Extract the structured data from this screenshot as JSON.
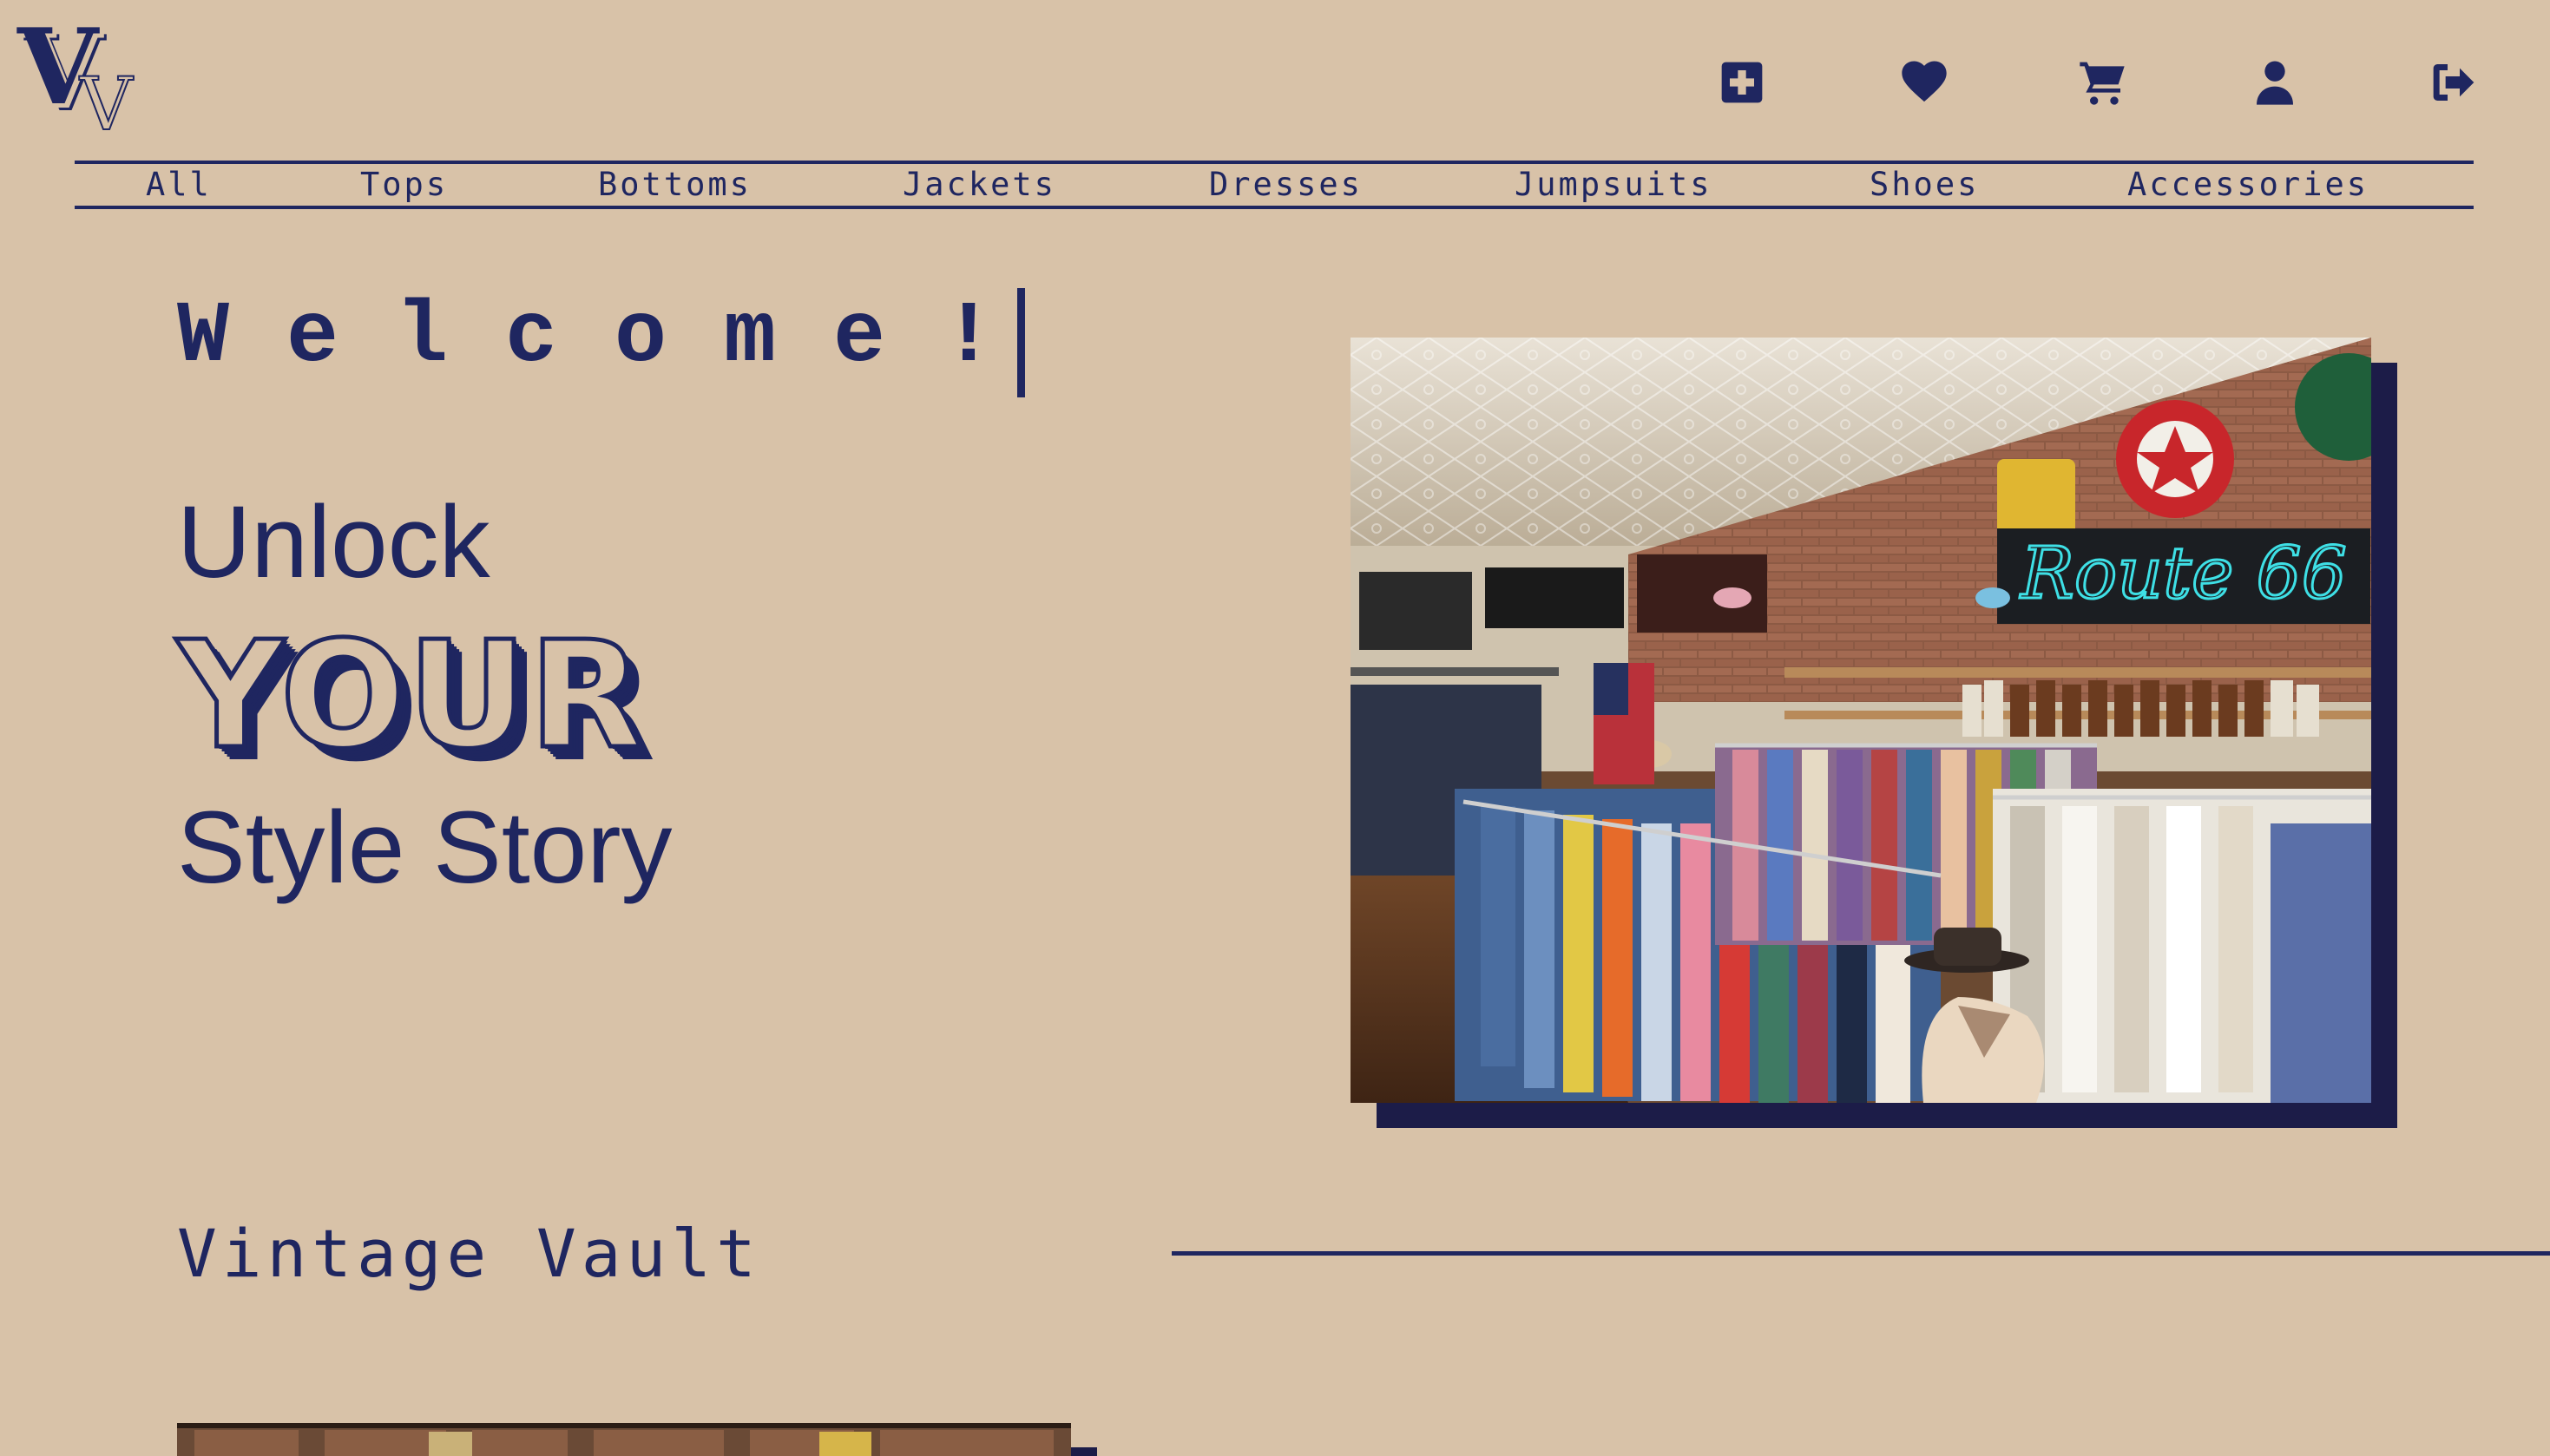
{
  "logo": {
    "big_letter": "V",
    "small_letter": "V"
  },
  "header_icons": [
    {
      "name": "add-icon",
      "label": "Add"
    },
    {
      "name": "heart-icon",
      "label": "Favorites"
    },
    {
      "name": "cart-icon",
      "label": "Cart"
    },
    {
      "name": "user-icon",
      "label": "Account"
    },
    {
      "name": "logout-icon",
      "label": "Log out"
    }
  ],
  "nav": {
    "items": [
      "All",
      "Tops",
      "Bottoms",
      "Jackets",
      "Dresses",
      "Jumpsuits",
      "Shoes",
      "Accessories"
    ]
  },
  "hero": {
    "welcome": "Welcome!",
    "line1": "Unlock",
    "line2": "YOUR",
    "line3": "Style Story",
    "image_alt": "Vintage clothing store interior with Route 66 neon sign"
  },
  "section": {
    "title": "Vintage Vault"
  },
  "colors": {
    "background": "#d8c2a8",
    "primary": "#1f2660",
    "shadow": "#1c1c48"
  }
}
